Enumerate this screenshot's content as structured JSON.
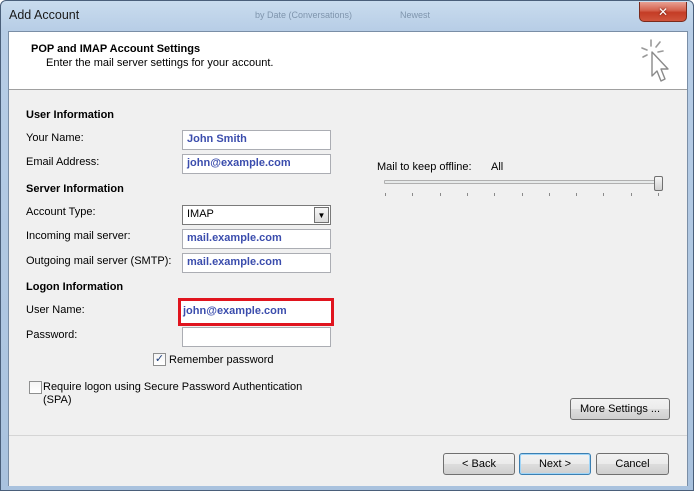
{
  "window": {
    "title": "Add Account",
    "background_text": [
      "by Date (Conversations)",
      "Newest"
    ],
    "close_glyph": "✕"
  },
  "header": {
    "title": "POP and IMAP Account Settings",
    "subtitle": "Enter the mail server settings for your account."
  },
  "user_info": {
    "section_label": "User Information",
    "name_label": "Your Name:",
    "name_value": "John Smith",
    "email_label": "Email Address:",
    "email_value": "john@example.com"
  },
  "server_info": {
    "section_label": "Server Information",
    "account_type_label": "Account Type:",
    "account_type_value": "IMAP",
    "incoming_label": "Incoming mail server:",
    "incoming_value": "mail.example.com",
    "outgoing_label": "Outgoing mail server (SMTP):",
    "outgoing_value": "mail.example.com"
  },
  "logon_info": {
    "section_label": "Logon Information",
    "username_label": "User Name:",
    "username_value": "john@example.com",
    "password_label": "Password:",
    "password_value": "",
    "remember_label": "Remember password",
    "remember_checked": true,
    "spa_label_line1": "Require logon using Secure Password Authentication",
    "spa_label_line2": "(SPA)",
    "spa_checked": false
  },
  "offline": {
    "label": "Mail to keep offline:",
    "value": "All",
    "slider_level": 1.0
  },
  "buttons": {
    "more_settings": "More Settings ...",
    "back": "< Back",
    "next": "Next >",
    "cancel": "Cancel"
  },
  "colors": {
    "field_text": "#3b4dad",
    "highlight_border": "#e0141e"
  },
  "icons": {
    "close": "close-icon",
    "wizard": "cursor-click-icon",
    "dropdown": "chevron-down-icon",
    "check": "checkmark-icon"
  }
}
